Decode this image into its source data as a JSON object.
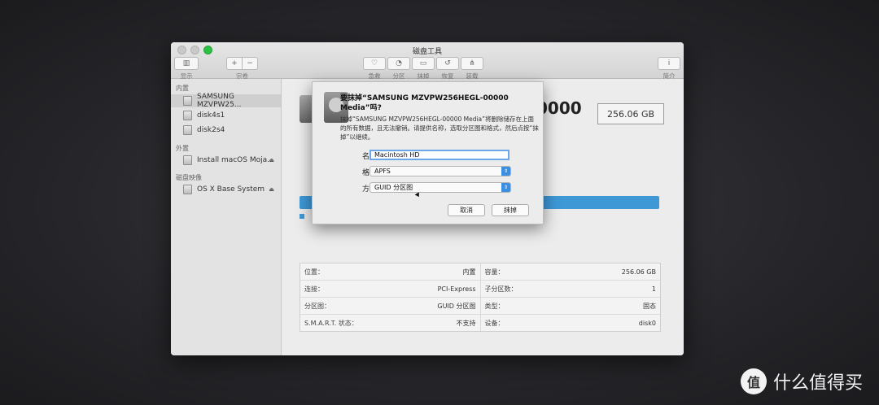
{
  "window": {
    "title": "磁盘工具"
  },
  "toolbar": {
    "view_label": "显示",
    "volume_label": "宗卷",
    "add_glyph": "+",
    "remove_glyph": "−",
    "first_aid_label": "急救",
    "partition_label": "分区",
    "erase_label": "抹掉",
    "restore_label": "恢复",
    "mount_label": "装载",
    "info_label": "简介",
    "info_glyph": "i"
  },
  "sidebar": {
    "internal_header": "内置",
    "external_header": "外置",
    "image_header": "磁盘映像",
    "internal_items": [
      "SAMSUNG MZVPW25...",
      "disk4s1",
      "disk2s4"
    ],
    "external_items": [
      "Install macOS Moja..."
    ],
    "image_items": [
      "OS X Base System"
    ]
  },
  "main": {
    "disk_title_tail": "0000",
    "capacity": "256.06 GB",
    "info_rows": [
      [
        {
          "k": "位置：",
          "v": "内置"
        },
        {
          "k": "容量：",
          "v": "256.06 GB"
        }
      ],
      [
        {
          "k": "连接：",
          "v": "PCI-Express"
        },
        {
          "k": "子分区数：",
          "v": "1"
        }
      ],
      [
        {
          "k": "分区图：",
          "v": "GUID 分区图"
        },
        {
          "k": "类型：",
          "v": "固态"
        }
      ],
      [
        {
          "k": "S.M.A.R.T. 状态：",
          "v": "不支持"
        },
        {
          "k": "设备：",
          "v": "disk0"
        }
      ]
    ]
  },
  "sheet": {
    "title": "要抹掉“SAMSUNG MZVPW256HEGL-00000 Media”吗?",
    "message": "抹掉“SAMSUNG MZVPW256HEGL-00000 Media”将删除储存在上面的所有数据，且无法撤销。请提供名称，选取分区图和格式，然后点按“抹掉”以继续。",
    "name_label": "名称:",
    "name_value": "Macintosh HD",
    "format_label": "格式:",
    "format_value": "APFS",
    "scheme_label": "方案:",
    "scheme_value": "GUID 分区图",
    "cancel_label": "取消",
    "erase_label": "抹掉"
  },
  "watermark": {
    "logo": "值",
    "text": "什么值得买"
  }
}
